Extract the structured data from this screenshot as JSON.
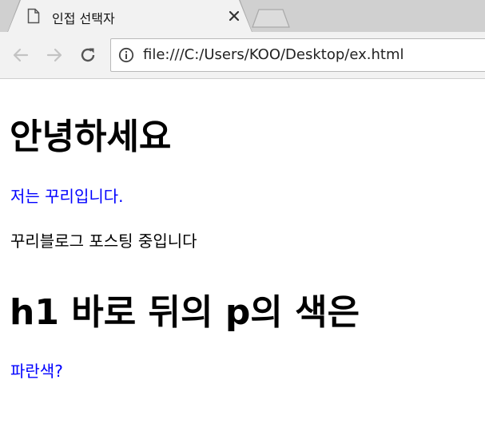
{
  "tab": {
    "title": "인접 선택자",
    "icon": "document-icon",
    "close_icon": "close-icon"
  },
  "toolbar": {
    "back_icon": "arrow-left-icon",
    "forward_icon": "arrow-right-icon",
    "reload_icon": "reload-icon",
    "info_icon": "info-icon",
    "url": "file:///C:/Users/KOO/Desktop/ex.html"
  },
  "content": {
    "heading1": "안녕하세요",
    "para1": "저는 꾸리입니다.",
    "para2": "꾸리블로그 포스팅 중입니다",
    "heading2": "h1 바로 뒤의 p의 색은",
    "para3": "파란색?"
  },
  "colors": {
    "blue_text": "#0000ff",
    "black_text": "#000000"
  }
}
